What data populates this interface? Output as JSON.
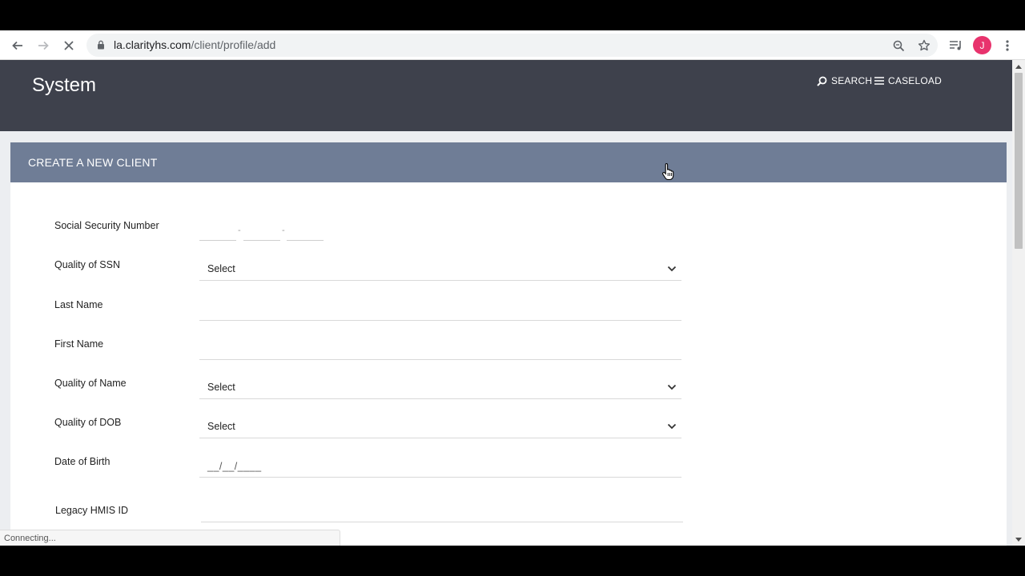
{
  "browser": {
    "url_host": "la.clarityhs.com",
    "url_path": "/client/profile/add",
    "avatar_initial": "J",
    "status_text": "Connecting..."
  },
  "header": {
    "title": "System",
    "search_label": "SEARCH",
    "caseload_label": "CASELOAD"
  },
  "form": {
    "title": "CREATE A NEW CLIENT",
    "fields": {
      "ssn_label": "Social Security Number",
      "ssn_quality_label": "Quality of SSN",
      "ssn_quality_value": "Select",
      "last_name_label": "Last Name",
      "first_name_label": "First Name",
      "name_quality_label": "Quality of Name",
      "name_quality_value": "Select",
      "dob_quality_label": "Quality of DOB",
      "dob_quality_value": "Select",
      "dob_label": "Date of Birth",
      "dob_mask": "__/__/____",
      "legacy_id_label": "Legacy HMIS ID"
    }
  },
  "colors": {
    "header_bg": "#3e414c",
    "panel_header_bg": "#6f7d96",
    "avatar": "#e8336d"
  },
  "icons": [
    "back-arrow-icon",
    "forward-arrow-icon",
    "stop-loading-icon",
    "lock-icon",
    "zoom-icon",
    "star-icon",
    "media-queue-icon",
    "kebab-menu-icon",
    "search-icon",
    "list-icon",
    "chevron-down-icon",
    "hand-cursor-icon"
  ]
}
